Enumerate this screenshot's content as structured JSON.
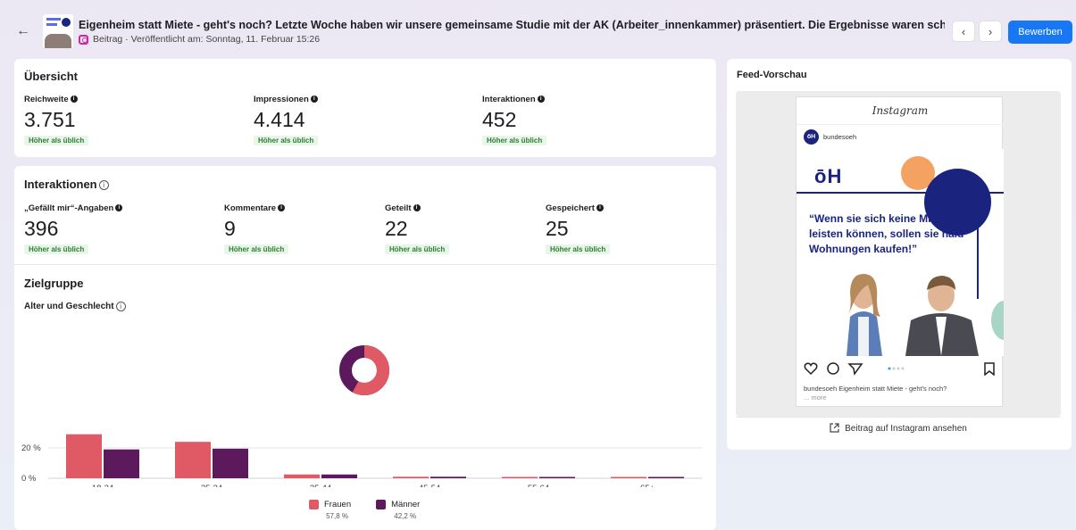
{
  "header": {
    "title": "Eigenheim statt Miete - geht's noch? Letzte Woche haben wir unsere gemeinsame Studie mit der AK (Arbeiter_innenkammer) präsentiert. Die Ergebnisse waren schockierend! ...",
    "subtitle": "Beitrag · Veröffentlicht am: Sonntag, 11. Februar 15:26",
    "prev": "‹",
    "next": "›",
    "back": "←",
    "cta": "Bewerben"
  },
  "overview": {
    "title": "Übersicht",
    "metrics": [
      {
        "label": "Reichweite",
        "value": "3.751",
        "badge": "Höher als üblich"
      },
      {
        "label": "Impressionen",
        "value": "4.414",
        "badge": "Höher als üblich"
      },
      {
        "label": "Interaktionen",
        "value": "452",
        "badge": "Höher als üblich"
      }
    ]
  },
  "interactions": {
    "title": "Interaktionen",
    "metrics": [
      {
        "label": "„Gefällt mir“-Angaben",
        "value": "396",
        "badge": "Höher als üblich"
      },
      {
        "label": "Kommentare",
        "value": "9",
        "badge": "Höher als üblich"
      },
      {
        "label": "Geteilt",
        "value": "22",
        "badge": "Höher als üblich"
      },
      {
        "label": "Gespeichert",
        "value": "25",
        "badge": "Höher als üblich"
      }
    ]
  },
  "audience": {
    "title": "Zielgruppe",
    "subtitle": "Alter und Geschlecht"
  },
  "chart_data": {
    "type": "bar",
    "categories": [
      "18-24",
      "25-34",
      "35-44",
      "45-54",
      "55-64",
      "65+"
    ],
    "series": [
      {
        "name": "Frauen",
        "values": [
          29,
          24,
          2.5,
          1,
          0.5,
          0.5
        ],
        "total": "57,8 %"
      },
      {
        "name": "Männer",
        "values": [
          19,
          19.5,
          2.5,
          1,
          0.5,
          0.5
        ],
        "total": "42,2 %"
      }
    ],
    "yticks": [
      "0 %",
      "20 %"
    ],
    "ylim": [
      0,
      35
    ],
    "donut": {
      "Frauen": 57.8,
      "Männer": 42.2
    },
    "colors": {
      "Frauen": "#e05a66",
      "Männer": "#5c1a5c"
    }
  },
  "preview": {
    "title": "Feed-Vorschau",
    "platform": "Instagram",
    "account": "bundesoeh",
    "avatar": "öH",
    "logo": "ōH",
    "quote": "“Wenn sie sich keine Miete leisten können, sollen sie hald Wohnungen kaufen!”",
    "caption_account": "bundesoeh",
    "caption_text": "Eigenheim statt Miete - geht's noch?",
    "more": "... more",
    "link": "Beitrag auf Instagram ansehen"
  }
}
